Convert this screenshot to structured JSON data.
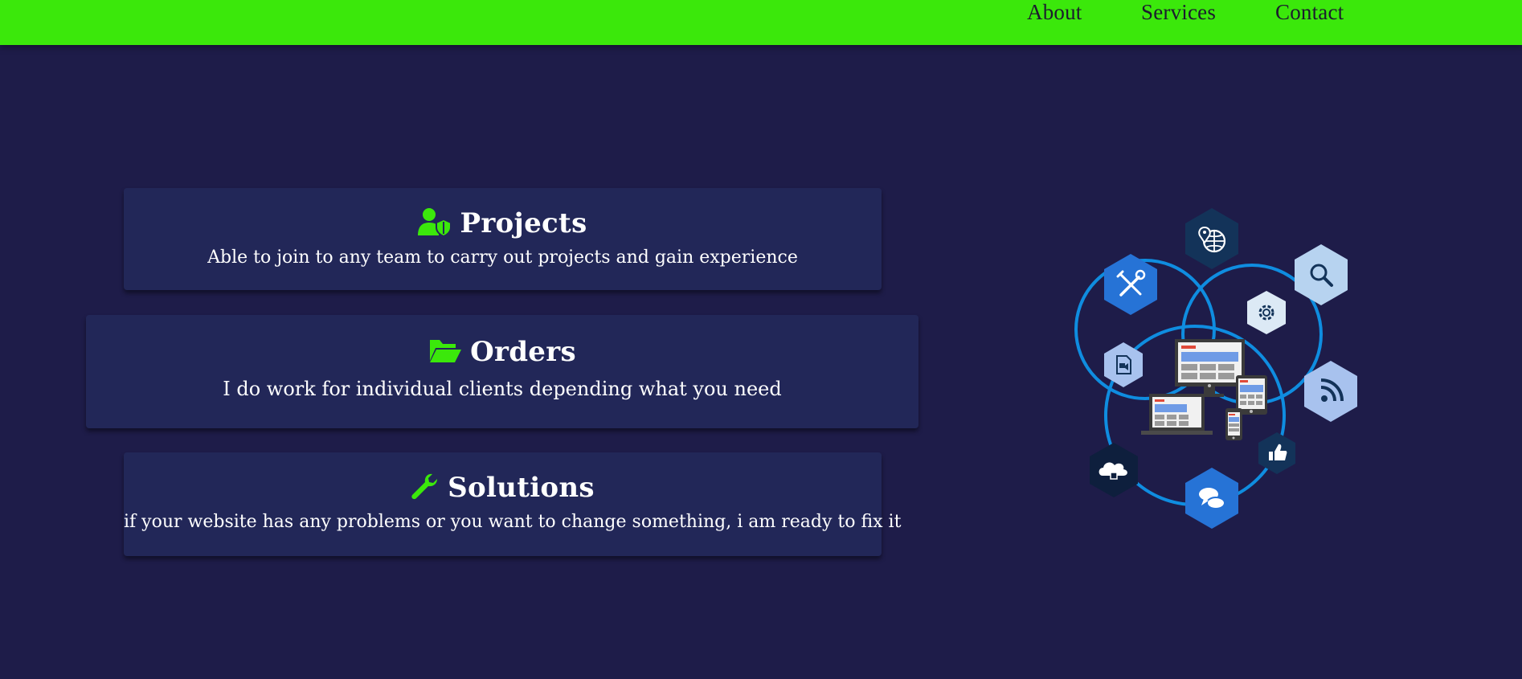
{
  "nav": {
    "links": [
      "About",
      "Services",
      "Contact"
    ]
  },
  "cards": [
    {
      "icon": "user-shield-icon",
      "title": "Projects",
      "text": "Able to join to any team to carry out projects and gain experience"
    },
    {
      "icon": "folder-open-icon",
      "title": "Orders",
      "text": "I do work for individual clients depending what you need"
    },
    {
      "icon": "wrench-icon",
      "title": "Solutions",
      "text": "if your website has any problems or you want to change something, i am ready to fix it"
    }
  ],
  "illustration": {
    "name": "web-development-devices-illustration",
    "icons": [
      "globe-pin-icon",
      "tools-icon",
      "magnifier-icon",
      "gear-icon",
      "video-file-icon",
      "rss-icon",
      "thumbs-up-icon",
      "cloud-icon",
      "chat-bubbles-icon"
    ]
  },
  "colors": {
    "header": "#3be80b",
    "background": "#1e1c49",
    "card": "#222758",
    "accent_green": "#3be80b",
    "ring_blue": "#0f8de0"
  }
}
